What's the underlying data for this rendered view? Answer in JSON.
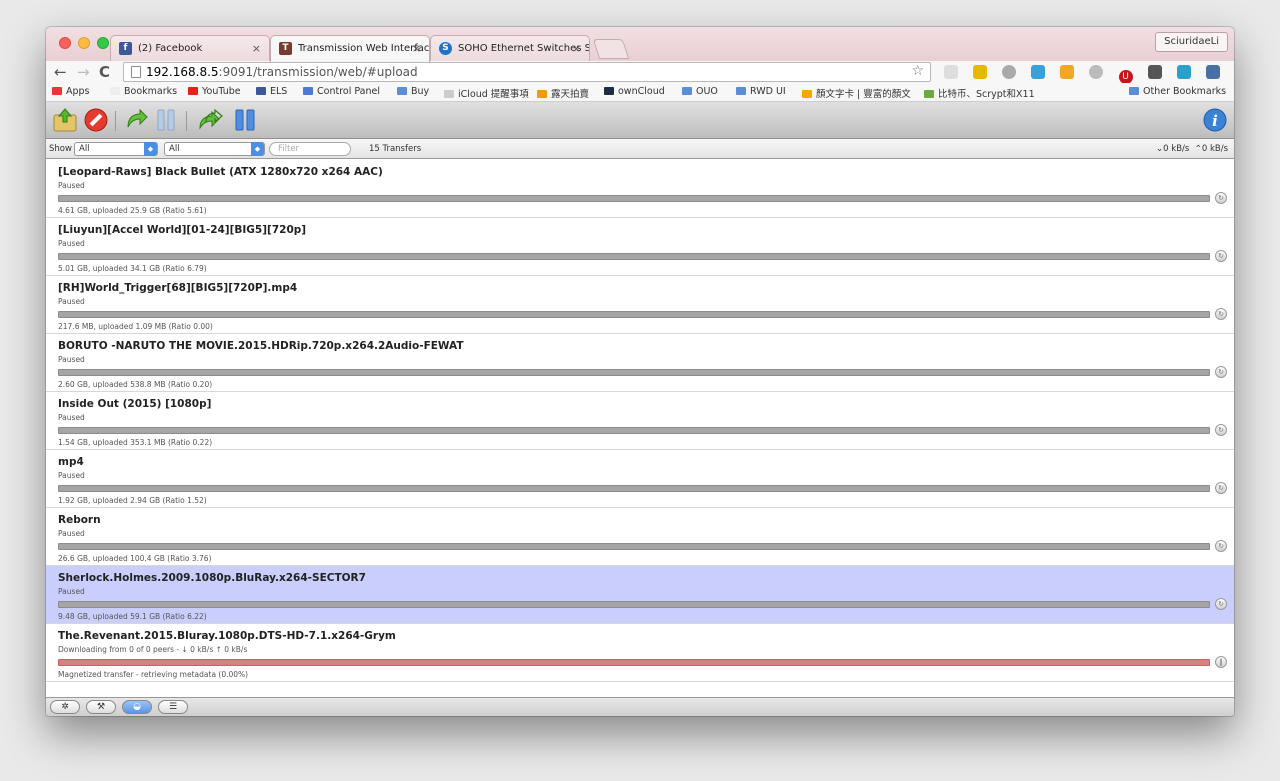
{
  "browser": {
    "tabs": [
      {
        "label": "(2) Facebook",
        "favicon": "f",
        "color": "#3b5998"
      },
      {
        "label": "Transmission Web Interface",
        "favicon": "T",
        "color": "#7a3b2e"
      },
      {
        "label": "SOHO Ethernet Switches S",
        "favicon": "S",
        "color": "#1f73c4"
      }
    ],
    "user": "SciuridaeLi",
    "url_host": "192.168.8.5",
    "url_path": ":9091/transmission/web/#upload"
  },
  "bookmarks": [
    {
      "label": "Apps",
      "color": "#e33"
    },
    {
      "label": "Bookmarks",
      "color": "#f7f7f7"
    },
    {
      "label": "YouTube",
      "color": "#e62117"
    },
    {
      "label": "ELS",
      "color": "#3b5998"
    },
    {
      "label": "Control Panel",
      "color": "#4b7bd6"
    },
    {
      "label": "Buy",
      "color": "#5b8ed6"
    },
    {
      "label": "iCloud 提醒事項",
      "color": "#bbb"
    },
    {
      "label": "露天拍賣",
      "color": "#f59b00"
    },
    {
      "label": "ownCloud",
      "color": "#1d2d44"
    },
    {
      "label": "OUO",
      "color": "#5b8ed6"
    },
    {
      "label": "RWD UI",
      "color": "#5b8ed6"
    },
    {
      "label": "顏文字卡 | 豐富的顏文",
      "color": "#f7a800"
    },
    {
      "label": "比特币、Scrypt和X11",
      "color": "#6cab3c"
    },
    {
      "label": "Other Bookmarks",
      "color": "#5b8ed6"
    }
  ],
  "filterbar": {
    "show_label": "Show",
    "state_filter": "All",
    "tracker_filter": "All",
    "filter_placeholder": "Filter",
    "count": "15 Transfers",
    "down_speed": "0 kB/s",
    "up_speed": "0 kB/s"
  },
  "torrents": [
    {
      "name": "[Leopard-Raws] Black Bullet (ATX 1280x720 x264 AAC)",
      "status": "Paused",
      "info": "4.61 GB, uploaded 25.9 GB (Ratio 5.61)",
      "progress": 1.0,
      "state": "paused"
    },
    {
      "name": "[Liuyun][Accel World][01-24][BIG5][720p]",
      "status": "Paused",
      "info": "5.01 GB, uploaded 34.1 GB (Ratio 6.79)",
      "progress": 1.0,
      "state": "paused"
    },
    {
      "name": "[RH]World_Trigger[68][BIG5][720P].mp4",
      "status": "Paused",
      "info": "217.6 MB, uploaded 1.09 MB (Ratio 0.00)",
      "progress": 1.0,
      "state": "paused"
    },
    {
      "name": "BORUTO -NARUTO THE MOVIE.2015.HDRip.720p.x264.2Audio-FEWAT",
      "status": "Paused",
      "info": "2.60 GB, uploaded 538.8 MB (Ratio 0.20)",
      "progress": 1.0,
      "state": "paused"
    },
    {
      "name": "Inside Out (2015) [1080p]",
      "status": "Paused",
      "info": "1.54 GB, uploaded 353.1 MB (Ratio 0.22)",
      "progress": 1.0,
      "state": "paused"
    },
    {
      "name": "mp4",
      "status": "Paused",
      "info": "1.92 GB, uploaded 2.94 GB (Ratio 1.52)",
      "progress": 1.0,
      "state": "paused"
    },
    {
      "name": "Reborn",
      "status": "Paused",
      "info": "26.6 GB, uploaded 100.4 GB (Ratio 3.76)",
      "progress": 1.0,
      "state": "paused"
    },
    {
      "name": "Sherlock.Holmes.2009.1080p.BluRay.x264-SECTOR7",
      "status": "Paused",
      "info": "9.48 GB, uploaded 59.1 GB (Ratio 6.22)",
      "progress": 1.0,
      "state": "paused",
      "selected": true
    },
    {
      "name": "The.Revenant.2015.Bluray.1080p.DTS-HD-7.1.x264-Grym",
      "status": "Downloading from 0 of 0 peers - ↓ 0 kB/s ↑ 0 kB/s",
      "info": "Magnetized transfer - retrieving metadata (0.00%)",
      "progress": 1.0,
      "state": "downloading"
    }
  ]
}
